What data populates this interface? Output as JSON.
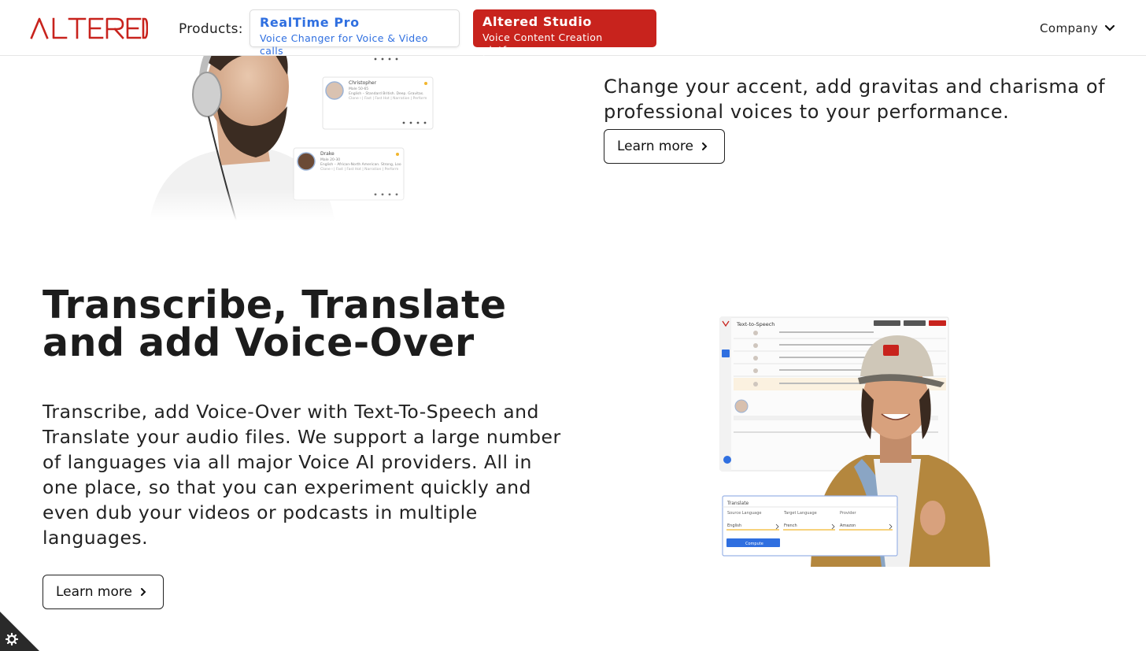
{
  "header": {
    "products_label": "Products:",
    "company_label": "Company",
    "brand_color": "#c8231d"
  },
  "products": [
    {
      "title": "RealTime Pro",
      "subtitle": "Voice Changer for Voice & Video calls",
      "color": "#2f6fe0"
    },
    {
      "title": "Altered Studio",
      "subtitle": "Voice Content Creation platform",
      "color": "#c8231d"
    }
  ],
  "section_top": {
    "copy": "Change your accent, add gravitas and charisma of professional voices to your performance.",
    "cta": "Learn more",
    "voice_cards": [
      {
        "name": "Christopher",
        "meta": "Male 50-65",
        "detail": "English – Standard British. Deep. Gravitas.",
        "tags": "Clone ⁞ | Fast | Fast Hot | Narration | Perform"
      },
      {
        "name": "Drake",
        "meta": "Male 20-30",
        "detail": "English – African-North American. Strong, Loo",
        "tags": "Clone ⁞ | Fast | Fast Hot | Narration | Perform"
      }
    ]
  },
  "section_main": {
    "title": "Transcribe, Translate and add Voice-Over",
    "copy": "Transcribe, add Voice-Over with Text-To-Speech and Translate your audio files. We support a large number of languages via all major Voice AI providers. All in one place, so that you can experiment quickly and even dub your videos or podcasts in multiple languages.",
    "cta": "Learn more",
    "app": {
      "window_title": "Text-to-Speech",
      "translate_panel": {
        "title": "Translate",
        "source_label": "Source Language",
        "target_label": "Target Language",
        "provider_label": "Provider",
        "source_value": "English",
        "target_value": "French",
        "provider_value": "Amazon",
        "compute_label": "Compute"
      }
    }
  }
}
